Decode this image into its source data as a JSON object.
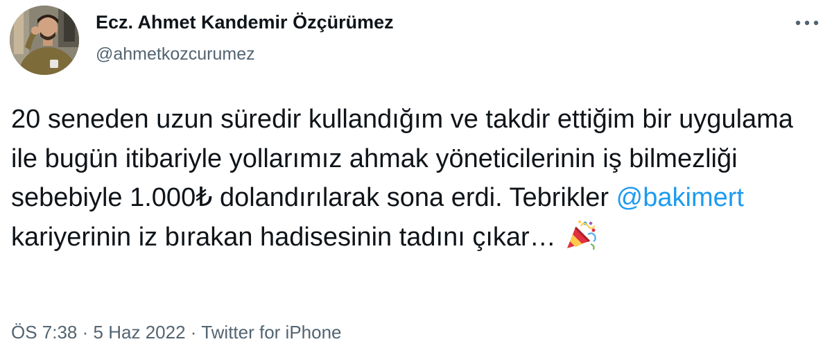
{
  "author": {
    "name": "Ecz. Ahmet Kandemir Özçürümez",
    "handle": "@ahmetkozcurumez"
  },
  "more_icon": "more-dots-icon",
  "tweet": {
    "text_before_mention": "20 seneden uzun süredir kullandığım ve takdir ettiğim bir uygulama ile bugün itibariyle yollarımız ahmak yöneticilerinin iş bilmezliği sebebiyle 1.000₺ dolandırılarak sona erdi. Tebrikler",
    "mention": "@bakimert",
    "text_after_mention": "kariyerinin iz bırakan hadisesinin tadını çıkar…",
    "emoji": "party-popper-icon"
  },
  "meta": {
    "time": "ÖS 7:38",
    "separator": "·",
    "date": "5 Haz 2022",
    "source": "Twitter for iPhone"
  },
  "colors": {
    "text": "#0f1419",
    "secondary": "#536471",
    "accent": "#1d9bf0"
  }
}
